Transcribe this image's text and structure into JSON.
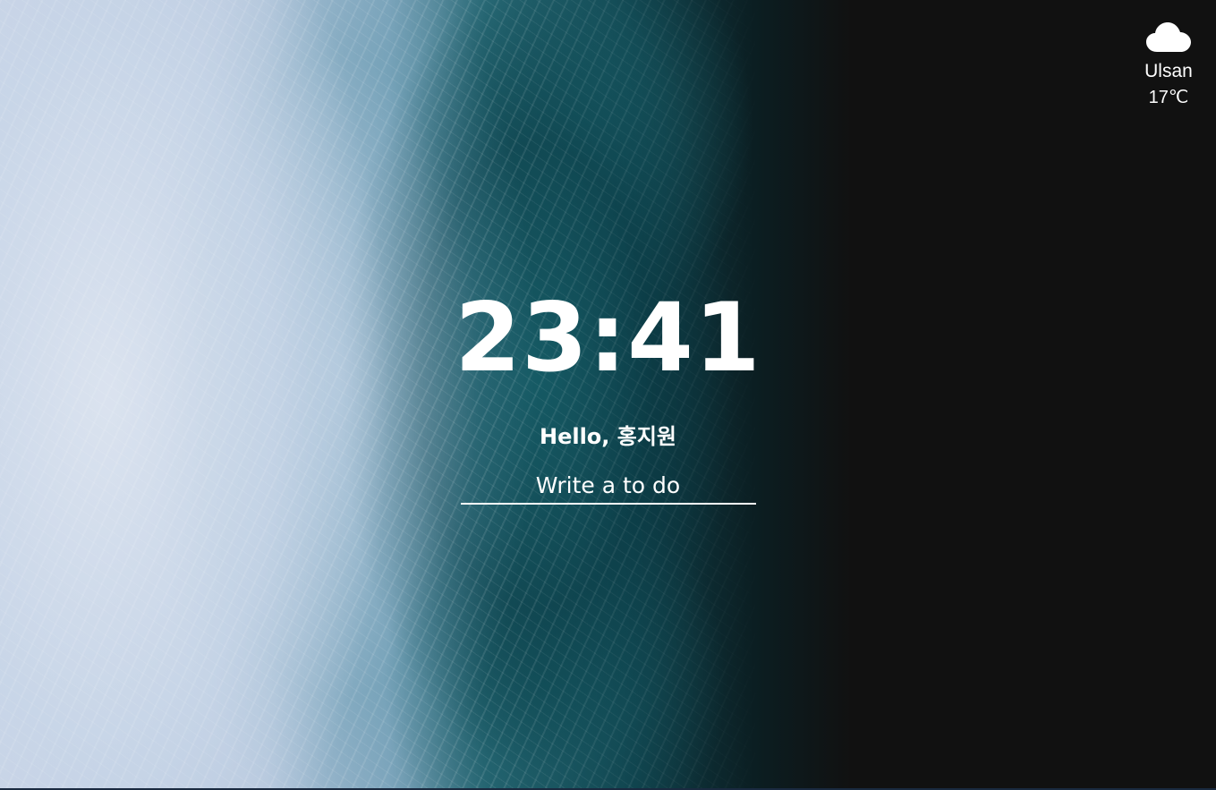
{
  "weather": {
    "icon": "cloud-icon",
    "city": "Ulsan",
    "temperature": "17℃"
  },
  "clock": {
    "time": "23:41"
  },
  "greeting": {
    "text": "Hello, 홍지원"
  },
  "todo": {
    "placeholder": "Write a to do"
  },
  "colors": {
    "text": "#ffffff",
    "background_dark": "#111111",
    "ocean_teal": "#2b6b78",
    "foam_white": "#c9d3e6"
  }
}
